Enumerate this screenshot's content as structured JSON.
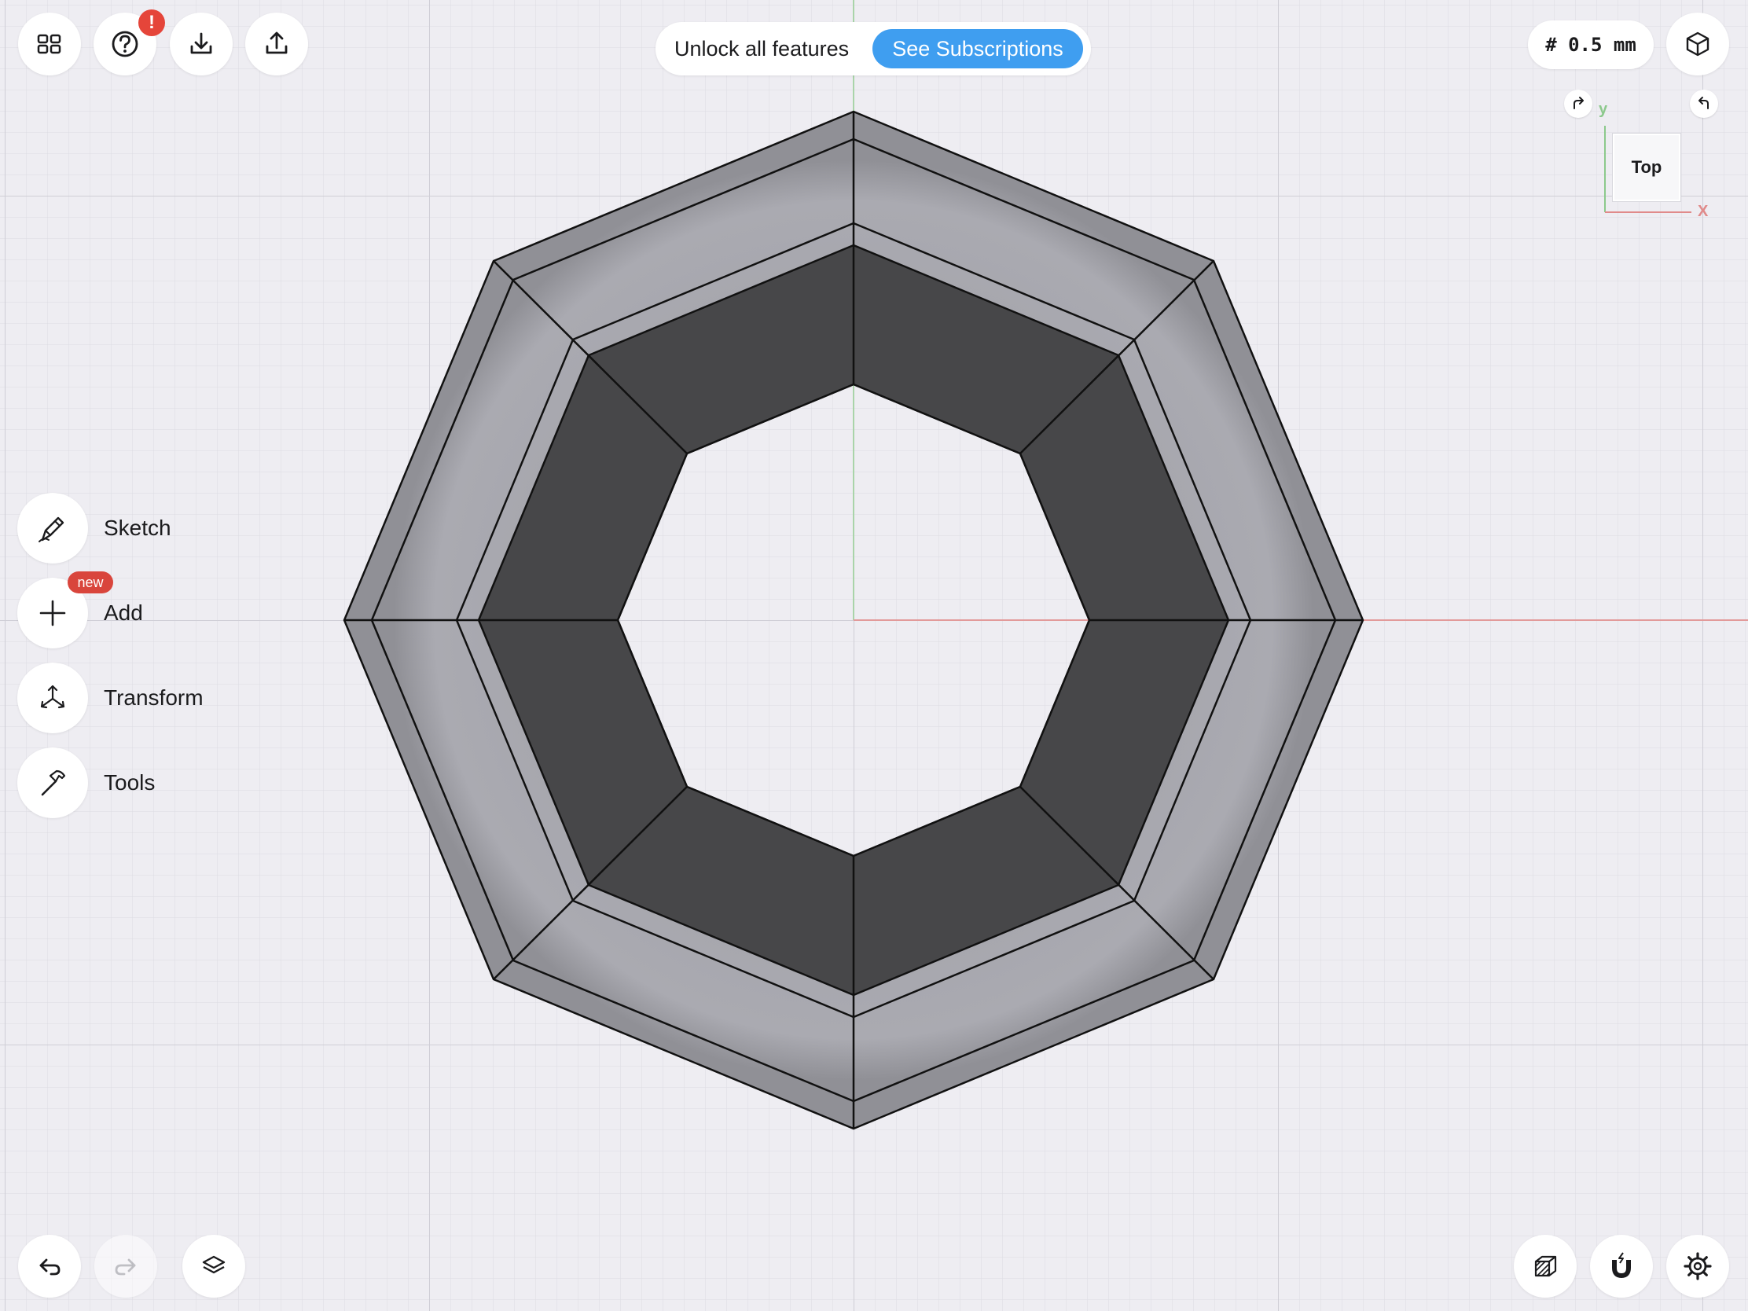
{
  "toolbar": {
    "alert_badge": "!",
    "icons": {
      "apps": "grid-icon",
      "help": "question-icon",
      "import": "download-icon",
      "export": "share-icon",
      "view_mode": "cube-icon"
    }
  },
  "promo": {
    "text": "Unlock all features",
    "button_label": "See Subscriptions",
    "button_color": "#3f9ef0"
  },
  "grid": {
    "label": "# 0.5 mm"
  },
  "view_cube": {
    "face_label": "Top",
    "y_label": "y",
    "x_label": "X",
    "y_color": "#8cc98c",
    "x_color": "#e08a8a"
  },
  "tools": [
    {
      "label": "Sketch",
      "icon": "sketch-pencil-icon"
    },
    {
      "label": "Add",
      "icon": "plus-icon",
      "badge": "new"
    },
    {
      "label": "Transform",
      "icon": "transform-arrows-icon"
    },
    {
      "label": "Tools",
      "icon": "hammer-icon"
    }
  ],
  "bottom_bar": {
    "undo": "undo-icon",
    "redo": "redo-icon",
    "layers": "layers-icon",
    "material": "material-cube-icon",
    "snap": "magnet-icon",
    "settings": "gear-icon"
  },
  "colors": {
    "canvas": "#eeedf2",
    "alert": "#e5453a",
    "badge_new": "#d9453c",
    "x_axis": "#e29a9a",
    "y_axis": "#a9d4a9",
    "model_dark": "#474749",
    "model_light": "#a8a8ae"
  }
}
